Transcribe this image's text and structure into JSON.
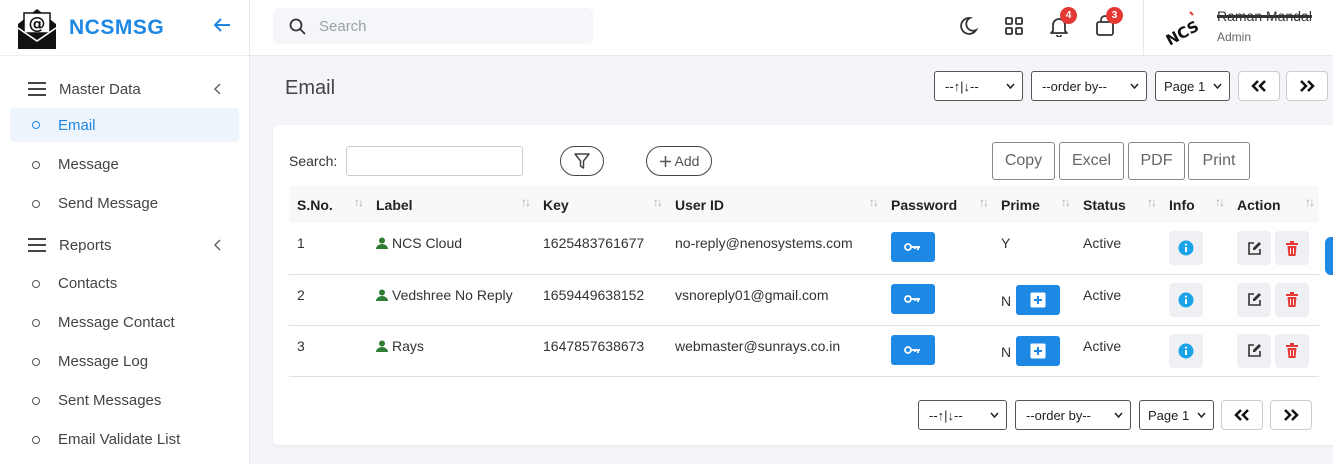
{
  "brand": {
    "name": "NCSMSG"
  },
  "sidebar": {
    "sections": [
      {
        "label": "Master Data",
        "items": [
          {
            "label": "Email",
            "active": true
          },
          {
            "label": "Message"
          },
          {
            "label": "Send Message"
          }
        ]
      },
      {
        "label": "Reports",
        "items": [
          {
            "label": "Contacts"
          },
          {
            "label": "Message Contact"
          },
          {
            "label": "Message Log"
          },
          {
            "label": "Sent Messages"
          },
          {
            "label": "Email Validate List"
          }
        ]
      }
    ]
  },
  "header": {
    "search_placeholder": "Search",
    "notifications_count": "4",
    "cart_count": "3",
    "user_name": "Raman Mandal",
    "user_role": "Admin",
    "user_logo_text": "NCS"
  },
  "page": {
    "title": "Email",
    "sort_select": "--↑|↓--",
    "order_select": "--order by--",
    "page_select": "Page 1"
  },
  "toolbar": {
    "search_label": "Search:",
    "add_label": "Add",
    "export_buttons": [
      "Copy",
      "Excel",
      "PDF",
      "Print"
    ]
  },
  "table": {
    "columns": [
      "S.No.",
      "Label",
      "Key",
      "User ID",
      "Password",
      "Prime",
      "Status",
      "Info",
      "Action"
    ],
    "rows": [
      {
        "sno": "1",
        "label": "NCS Cloud",
        "key": "1625483761677",
        "user_id": "no-reply@nenosystems.com",
        "prime": "Y",
        "status": "Active"
      },
      {
        "sno": "2",
        "label": "Vedshree No Reply",
        "key": "1659449638152",
        "user_id": "vsnoreply01@gmail.com",
        "prime": "N",
        "status": "Active"
      },
      {
        "sno": "3",
        "label": "Rays",
        "key": "1647857638673",
        "user_id": "webmaster@sunrays.co.in",
        "prime": "N",
        "status": "Active"
      }
    ]
  },
  "colors": {
    "accent": "#1e88e5",
    "badge": "#e53935",
    "delete": "#e53935",
    "info": "#1aa3e8",
    "user_icon": "#2e7d32"
  }
}
